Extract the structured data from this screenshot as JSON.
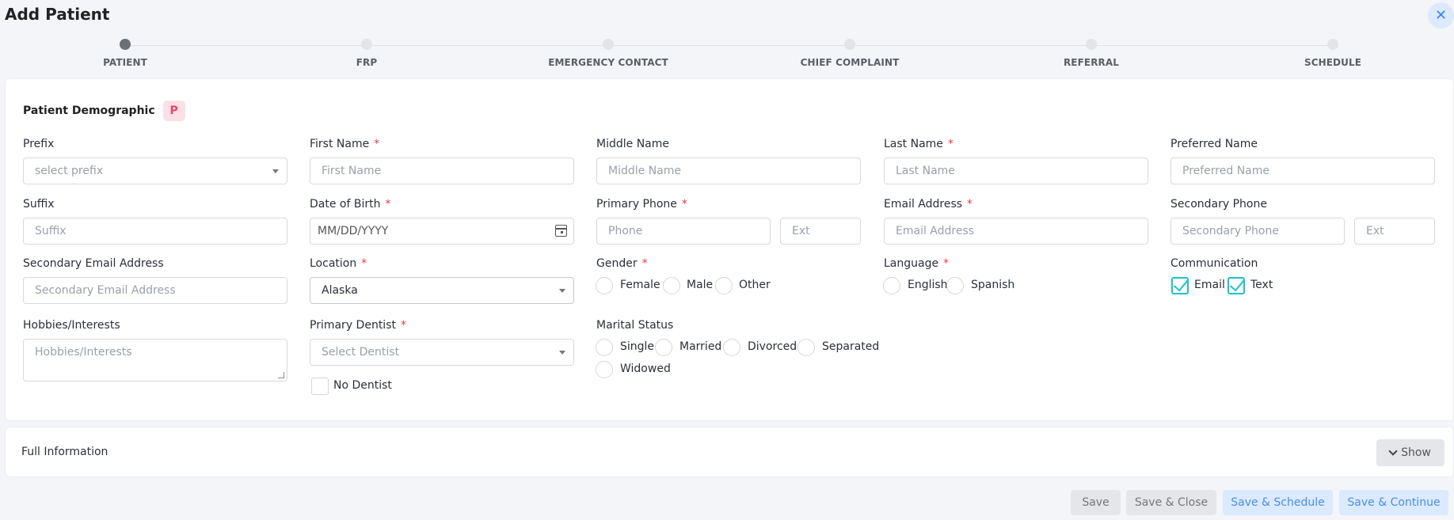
{
  "header": {
    "title": "Add Patient",
    "close_glyph": "✕"
  },
  "stepper": {
    "steps": [
      {
        "label": "PATIENT",
        "active": true
      },
      {
        "label": "FRP",
        "active": false
      },
      {
        "label": "EMERGENCY CONTACT",
        "active": false
      },
      {
        "label": "CHIEF COMPLAINT",
        "active": false
      },
      {
        "label": "REFERRAL",
        "active": false
      },
      {
        "label": "SCHEDULE",
        "active": false
      }
    ]
  },
  "section": {
    "title": "Patient Demographic",
    "badge": "P"
  },
  "fields": {
    "prefix": {
      "label": "Prefix",
      "placeholder": "select prefix"
    },
    "first_name": {
      "label": "First Name",
      "required": "*",
      "placeholder": "First Name"
    },
    "middle_name": {
      "label": "Middle Name",
      "placeholder": "Middle Name"
    },
    "last_name": {
      "label": "Last Name",
      "required": "*",
      "placeholder": "Last Name"
    },
    "preferred_name": {
      "label": "Preferred Name",
      "placeholder": "Preferred Name"
    },
    "suffix": {
      "label": "Suffix",
      "placeholder": "Suffix"
    },
    "dob": {
      "label": "Date of Birth",
      "required": "*",
      "placeholder": "MM/DD/YYYY"
    },
    "primary_phone": {
      "label": "Primary Phone",
      "required": "*",
      "placeholder": "Phone",
      "ext_placeholder": "Ext"
    },
    "email": {
      "label": "Email Address",
      "required": "*",
      "placeholder": "Email Address"
    },
    "secondary_phone": {
      "label": "Secondary Phone",
      "placeholder": "Secondary Phone",
      "ext_placeholder": "Ext"
    },
    "secondary_email": {
      "label": "Secondary Email Address",
      "placeholder": "Secondary Email Address"
    },
    "location": {
      "label": "Location",
      "required": "*",
      "value": "Alaska"
    },
    "gender": {
      "label": "Gender",
      "required": "*",
      "options": [
        "Female",
        "Male",
        "Other"
      ]
    },
    "language": {
      "label": "Language",
      "required": "*",
      "options": [
        "English",
        "Spanish"
      ]
    },
    "communication": {
      "label": "Communication",
      "options": [
        "Email",
        "Text"
      ]
    },
    "hobbies": {
      "label": "Hobbies/Interests",
      "placeholder": "Hobbies/Interests"
    },
    "primary_dentist": {
      "label": "Primary Dentist",
      "required": "*",
      "placeholder": "Select Dentist",
      "no_dentist": "No Dentist"
    },
    "marital_status": {
      "label": "Marital Status",
      "options": [
        "Single",
        "Married",
        "Divorced",
        "Separated",
        "Widowed"
      ]
    }
  },
  "full_info": {
    "label": "Full Information",
    "show": "Show"
  },
  "footer": {
    "save": "Save",
    "save_close": "Save & Close",
    "save_schedule": "Save & Schedule",
    "save_continue": "Save & Continue"
  }
}
